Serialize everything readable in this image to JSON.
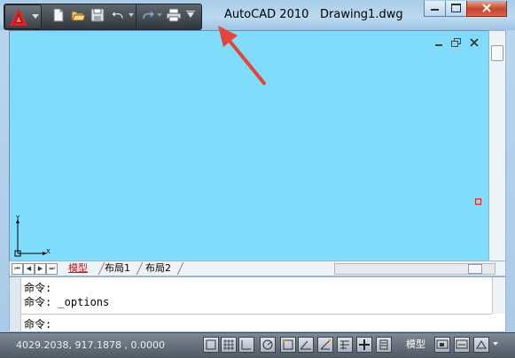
{
  "window": {
    "app_title": "AutoCAD 2010",
    "document_title": "Drawing1.dwg",
    "accent_colors": {
      "drawing_background": "#80dcfb",
      "qat_background": "#3e454d",
      "app_logo_red": "#d8262c",
      "active_tab": "#d01010",
      "annotation_arrow": "#e2463a"
    }
  },
  "quick_access_toolbar": {
    "app_menu_icon": "autocad-logo-icon",
    "buttons": [
      {
        "name": "new-icon"
      },
      {
        "name": "open-icon"
      },
      {
        "name": "save-icon"
      },
      {
        "name": "undo-icon"
      },
      {
        "name": "redo-icon"
      },
      {
        "name": "plot-icon"
      },
      {
        "name": "customize-dropdown-icon"
      }
    ]
  },
  "layout_tabs": {
    "nav_buttons": [
      "⏮",
      "◀",
      "▶",
      "⏭"
    ],
    "tabs": [
      "模型",
      "布局1",
      "布局2"
    ],
    "active": "模型"
  },
  "command_window": {
    "history": [
      "命令:",
      "命令: _options"
    ],
    "prompt": "命令:"
  },
  "status_bar": {
    "coordinates": "4029.2038, 917.1878 , 0.0000",
    "model_label": "模型"
  }
}
